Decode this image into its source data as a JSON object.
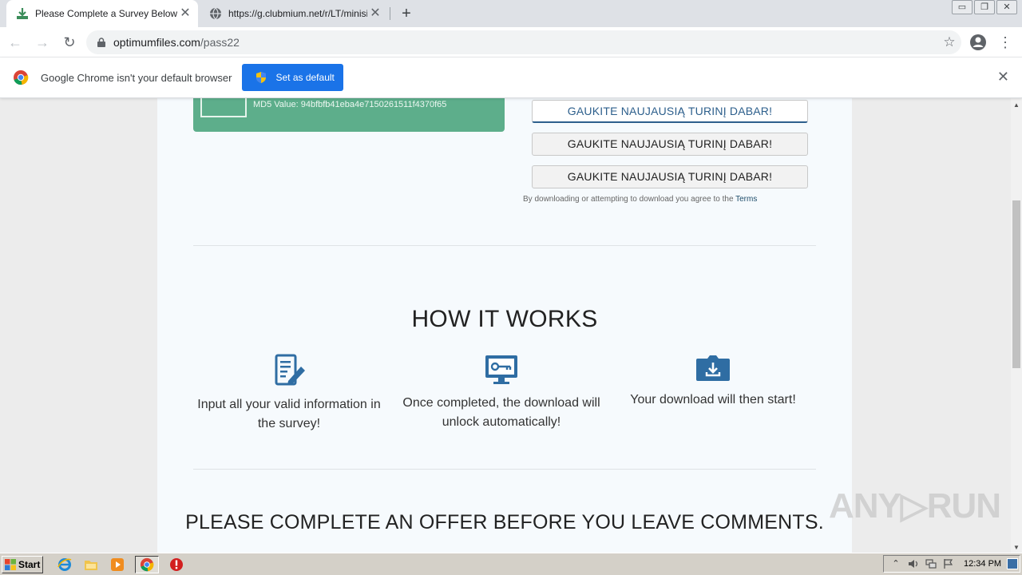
{
  "browser": {
    "tabs": [
      {
        "title": "Please Complete a Survey Below to Continue",
        "active": true,
        "close": "✕"
      },
      {
        "title": "https://g.clubmium.net/r/LT/minisite/",
        "active": false,
        "close": "✕"
      }
    ],
    "new_tab": "+",
    "window_controls": [
      "▭",
      "❐",
      "✕"
    ],
    "nav": {
      "back": "←",
      "forward": "→",
      "reload": "↻"
    },
    "url_host": "optimumfiles.com",
    "url_path": "/pass22",
    "bookmark_star": "☆",
    "menu": "⋮"
  },
  "infobar": {
    "message": "Google Chrome isn't your default browser",
    "button_label": "Set as default",
    "close": "✕"
  },
  "page": {
    "md5": "MD5 Value: 94bfbfb41eba4e7150261511f4370f65",
    "download_buttons": [
      "GAUKITE NAUJAUSIĄ TURINĮ DABAR!",
      "GAUKITE NAUJAUSIĄ TURINĮ DABAR!",
      "GAUKITE NAUJAUSIĄ TURINĮ DABAR!"
    ],
    "terms_prefix": "By downloading or attempting to download you agree to the",
    "terms_link": "Terms",
    "how_title": "HOW IT WORKS",
    "steps": [
      {
        "text": "Input all your valid information in the survey!",
        "icon": "form-edit-icon"
      },
      {
        "text": "Once completed, the download will unlock automatically!",
        "icon": "monitor-key-icon"
      },
      {
        "text": "Your download will then start!",
        "icon": "download-box-icon"
      }
    ],
    "offer_heading": "PLEASE COMPLETE AN OFFER BEFORE YOU LEAVE COMMENTS."
  },
  "watermark": "ANY▷RUN",
  "taskbar": {
    "start_label": "Start",
    "clock": "12:34 PM",
    "tray_icons": [
      "up-arrow-icon",
      "volume-icon",
      "network-icon",
      "flag-icon"
    ]
  },
  "colors": {
    "accent_blue": "#1a73e8",
    "green_box": "#5dae8b",
    "icon_blue": "#2f6da3",
    "page_bg": "#f6fafd"
  }
}
